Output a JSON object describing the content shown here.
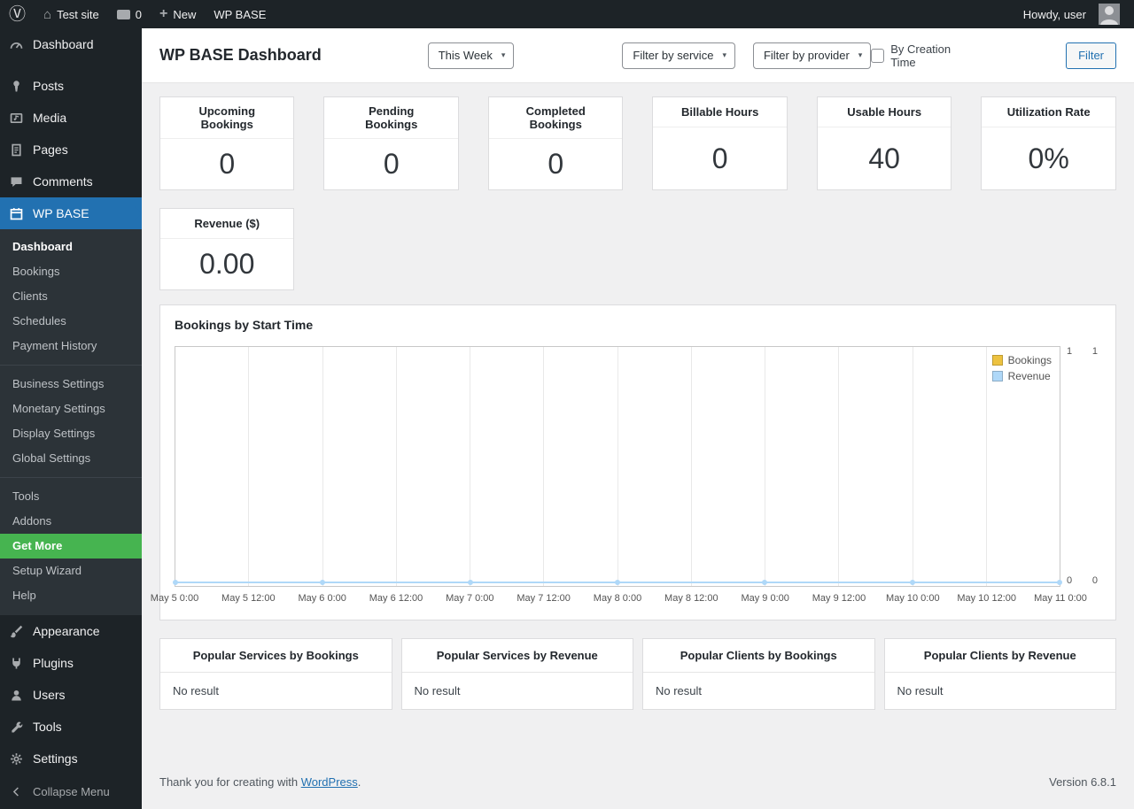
{
  "admin_bar": {
    "site_name": "Test site",
    "comments_count": "0",
    "new_label": "New",
    "plugin_label": "WP BASE",
    "howdy": "Howdy, user"
  },
  "sidebar": {
    "items": [
      "Dashboard",
      "Posts",
      "Media",
      "Pages",
      "Comments",
      "WP BASE",
      "Appearance",
      "Plugins",
      "Users",
      "Tools",
      "Settings"
    ],
    "submenu": [
      "Dashboard",
      "Bookings",
      "Clients",
      "Schedules",
      "Payment History",
      "Business Settings",
      "Monetary Settings",
      "Display Settings",
      "Global Settings",
      "Tools",
      "Addons",
      "Get More",
      "Setup Wizard",
      "Help"
    ],
    "collapse_label": "Collapse Menu"
  },
  "header": {
    "title": "WP BASE Dashboard",
    "period_filter": "This Week",
    "service_filter": "Filter by service",
    "provider_filter": "Filter by provider",
    "creation_time_label": "By Creation Time",
    "filter_button": "Filter"
  },
  "stats": [
    {
      "title": "Upcoming Bookings",
      "value": "0"
    },
    {
      "title": "Pending Bookings",
      "value": "0"
    },
    {
      "title": "Completed Bookings",
      "value": "0"
    },
    {
      "title": "Billable Hours",
      "value": "0"
    },
    {
      "title": "Usable Hours",
      "value": "40"
    },
    {
      "title": "Utilization Rate",
      "value": "0%"
    },
    {
      "title": "Revenue ($)",
      "value": "0.00"
    }
  ],
  "chart_data": {
    "type": "line",
    "title": "Bookings by Start Time",
    "x_labels": [
      "May 5 0:00",
      "May 5 12:00",
      "May 6 0:00",
      "May 6 12:00",
      "May 7 0:00",
      "May 7 12:00",
      "May 8 0:00",
      "May 8 12:00",
      "May 9 0:00",
      "May 9 12:00",
      "May 10 0:00",
      "May 10 12:00",
      "May 11 0:00"
    ],
    "series": [
      {
        "name": "Bookings",
        "color": "#edc240",
        "values": [
          0,
          0,
          0,
          0,
          0,
          0,
          0
        ]
      },
      {
        "name": "Revenue",
        "color": "#afd8f8",
        "values": [
          0,
          0,
          0,
          0,
          0,
          0,
          0
        ]
      }
    ],
    "right_axis_bookings": {
      "max": "1",
      "min": "0"
    },
    "right_axis_revenue": {
      "max": "1",
      "min": "0"
    },
    "ylim": [
      0,
      1
    ],
    "grid": "vertical",
    "legend_position": "top-right"
  },
  "panels": [
    {
      "title": "Popular Services by Bookings",
      "body": "No result"
    },
    {
      "title": "Popular Services by Revenue",
      "body": "No result"
    },
    {
      "title": "Popular Clients by Bookings",
      "body": "No result"
    },
    {
      "title": "Popular Clients by Revenue",
      "body": "No result"
    }
  ],
  "footer": {
    "thanks_text": "Thank you for creating with",
    "wordpress_link": "WordPress",
    "suffix": ".",
    "version": "Version 6.8.1"
  },
  "colors": {
    "accent_blue": "#2271b1",
    "success_green": "#46b450",
    "series_bookings": "#edc240",
    "series_revenue": "#afd8f8"
  }
}
